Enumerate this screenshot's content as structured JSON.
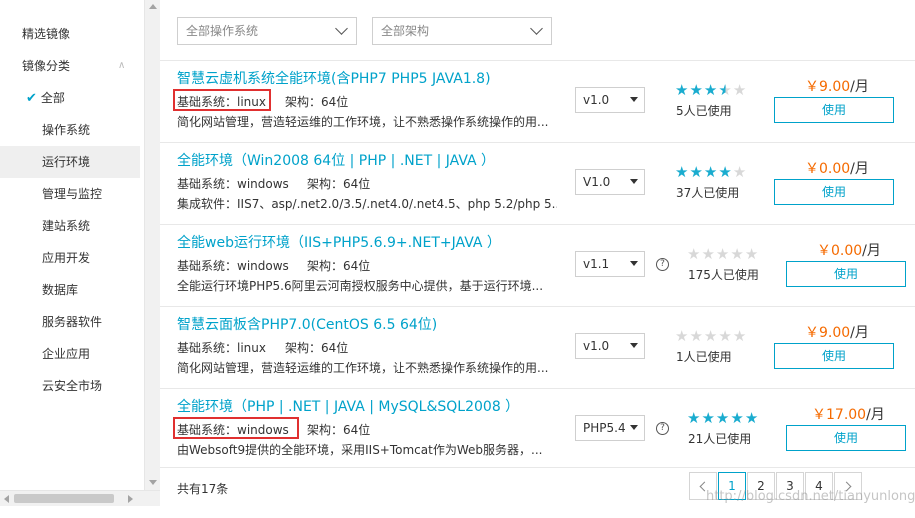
{
  "sidebar": {
    "featured": "精选镜像",
    "category": "镜像分类",
    "items": [
      "全部",
      "操作系统",
      "运行环境",
      "管理与监控",
      "建站系统",
      "应用开发",
      "数据库",
      "服务器软件",
      "企业应用",
      "云安全市场"
    ]
  },
  "filters": {
    "os": "全部操作系统",
    "arch": "全部架构"
  },
  "listings": [
    {
      "title": "智慧云虚机系统全能环境(含PHP7 PHP5 JAVA1.8)",
      "system": "基础系统：linux",
      "arch": "架构：64位",
      "desc": "简化网站管理，营造轻运维的工作环境，让不熟悉操作系统操作的用...",
      "version": "v1.0",
      "rating": 3.5,
      "users": "5人已使用",
      "price": "￥9.00",
      "unit": "/月",
      "use": "使用"
    },
    {
      "title": "全能环境（Win2008 64位 | PHP | .NET | JAVA ）",
      "system": "基础系统：windows",
      "arch": "架构：64位",
      "desc": "集成软件：IIS7、asp/.net2.0/3.5/.net4.0/.net4.5、php 5.2/php 5...",
      "version": "V1.0",
      "rating": 4,
      "users": "37人已使用",
      "price": "￥0.00",
      "unit": "/月",
      "use": "使用"
    },
    {
      "title": "全能web运行环境（IIS+PHP5.6.9+.NET+JAVA ）",
      "system": "基础系统：windows",
      "arch": "架构：64位",
      "desc": "全能运行环境PHP5.6阿里云河南授权服务中心提供，基于运行环境...",
      "version": "v1.1",
      "rating": 0,
      "users": "175人已使用",
      "price": "￥0.00",
      "unit": "/月",
      "use": "使用"
    },
    {
      "title": "智慧云面板含PHP7.0(CentOS 6.5 64位)",
      "system": "基础系统：linux",
      "arch": "架构：64位",
      "desc": "简化网站管理，营造轻运维的工作环境，让不熟悉操作系统操作的用...",
      "version": "v1.0",
      "rating": 0,
      "users": "1人已使用",
      "price": "￥9.00",
      "unit": "/月",
      "use": "使用"
    },
    {
      "title": "全能环境（PHP | .NET | JAVA | MySQL&SQL2008 ）",
      "system": "基础系统：windows",
      "arch": "架构：64位",
      "desc": "由Websoft9提供的全能环境，采用IIS+Tomcat作为Web服务器，...",
      "version": "PHP5.4",
      "rating": 5,
      "users": "21人已使用",
      "price": "￥17.00",
      "unit": "/月",
      "use": "使用"
    }
  ],
  "total": "共有17条",
  "pages": [
    "1",
    "2",
    "3",
    "4"
  ],
  "current_page": "1",
  "watermark": "http://blog.csdn.net/tianyunlong/",
  "colors": {
    "accent": "#00a2ca",
    "price": "#f56a00",
    "highlight_box": "#e03030"
  }
}
